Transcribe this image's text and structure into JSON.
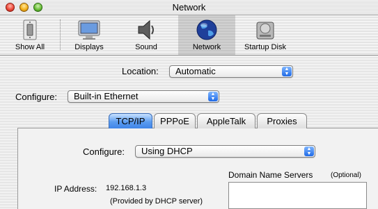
{
  "window": {
    "title": "Network"
  },
  "toolbar": {
    "items": [
      {
        "label": "Show All",
        "icon": "light-switch-icon"
      },
      {
        "label": "Displays",
        "icon": "display-monitor-icon"
      },
      {
        "label": "Sound",
        "icon": "speaker-icon"
      },
      {
        "label": "Network",
        "icon": "globe-icon",
        "selected": true
      },
      {
        "label": "Startup Disk",
        "icon": "hard-disk-icon"
      }
    ]
  },
  "location": {
    "label": "Location:",
    "value": "Automatic"
  },
  "configure_interface": {
    "label": "Configure:",
    "value": "Built-in Ethernet"
  },
  "tabs": [
    {
      "label": "TCP/IP",
      "active": true
    },
    {
      "label": "PPPoE"
    },
    {
      "label": "AppleTalk"
    },
    {
      "label": "Proxies"
    }
  ],
  "tcpip": {
    "configure_label": "Configure:",
    "configure_value": "Using DHCP",
    "ip_label": "IP Address:",
    "ip_value": "192.168.1.3",
    "ip_note": "(Provided by DHCP server)",
    "dns_label": "Domain Name Servers",
    "dns_optional": "(Optional)"
  },
  "colors": {
    "accent": "#3f84e8"
  }
}
